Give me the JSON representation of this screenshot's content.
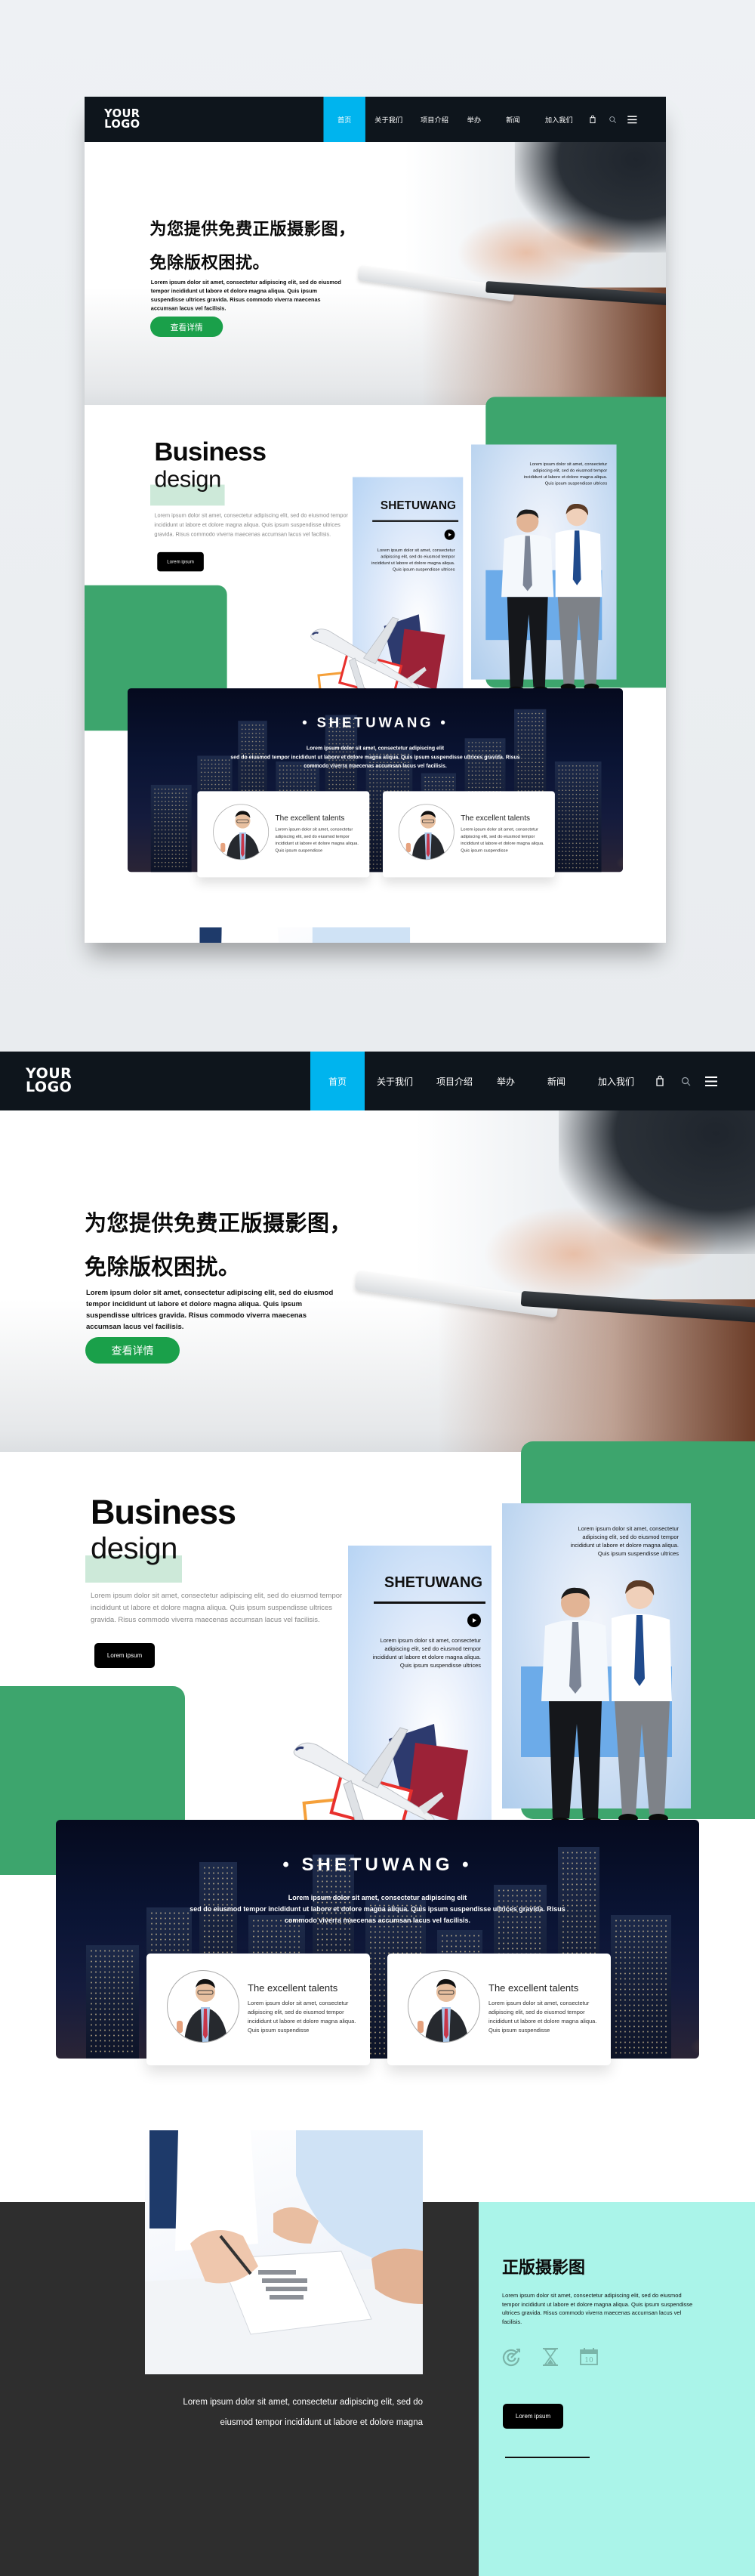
{
  "nav": {
    "logo_line1": "YOUR",
    "logo_line2": "LOGO",
    "items": [
      {
        "label": "首页",
        "active": true
      },
      {
        "label": "关于我们"
      },
      {
        "label": "项目介绍"
      },
      {
        "label": "举办"
      },
      {
        "label": "新闻"
      },
      {
        "label": "加入我们"
      }
    ],
    "icons": [
      "bag-icon",
      "search-icon",
      "menu-icon"
    ]
  },
  "hero": {
    "title_line1": "为您提供免费正版摄影图，",
    "title_line2": "免除版权困扰。",
    "body": "Lorem ipsum dolor sit amet, consectetur adipiscing elit, sed do eiusmod tempor incididunt ut labore et dolore magna aliqua. Quis ipsum suspendisse ultrices gravida. Risus commodo viverra maecenas accumsan lacus vel facilisis.",
    "button": "查看详情"
  },
  "business": {
    "title": "Business",
    "subtitle": "design",
    "body": "Lorem ipsum dolor sit amet, consectetur adipiscing elit, sed do eiusmod tempor incididunt ut labore et dolore magna aliqua. Quis ipsum suspendisse ultrices gravida. Risus commodo viverra maecenas accumsan lacus vel facilisis.",
    "button": "Lorem ipsum",
    "card1": {
      "title": "SHETUWANG",
      "text": "Lorem ipsum dolor sit amet, consectetur adipiscing elit, sed do eiusmod tempor incididunt ut labore et dolore magna aliqua. Quis ipsum suspendisse ultrices"
    },
    "card2": {
      "text": "Lorem ipsum dolor sit amet, consectetur adipiscing elit, sed do eiusmod tempor incididunt ut labore et dolore magna aliqua. Quis ipsum suspendisse ultrices"
    }
  },
  "city": {
    "title": "• SHETUWANG •",
    "body_line1": "Lorem ipsum dolor sit amet, consectetur adipiscing elit",
    "body_line2": "sed do eiusmod tempor incididunt ut labore et dolore magna aliqua. Quis ipsum suspendisse ultrices gravida. Risus",
    "body_line3": "commodo viverra maecenas accumsan lacus vel facilisis."
  },
  "talents": [
    {
      "name": "The excellent talents",
      "text": "Lorem ipsum dolor sit amet, consectetur adipiscing elit, sed do eiusmod tempor incididunt ut labore et dolore magna aliqua. Quis ipsum suspendisse"
    },
    {
      "name": "The excellent talents",
      "text": "Lorem ipsum dolor sit amet, consectetur adipiscing elit, sed do eiusmod tempor incididunt ut labore et dolore magna aliqua. Quis ipsum suspendisse"
    }
  ],
  "bottom": {
    "caption_line1": "Lorem ipsum dolor sit amet, consectetur adipiscing elit, sed do",
    "caption_line2": "eiusmod tempor incididunt ut labore et dolore magna",
    "title": "正版摄影图",
    "body": "Lorem ipsum dolor sit amet, consectetur adipiscing elit, sed do eiusmod tempor incididunt ut labore et dolore magna aliqua. Quis ipsum suspendisse ultrices gravida. Risus commodo viverra maecenas accumsan lacus vel facilisis.",
    "icons": [
      "target-icon",
      "hourglass-icon",
      "calendar-icon"
    ],
    "calendar_day": "10",
    "button": "Lorem ipsum"
  },
  "colors": {
    "nav_bg": "#0e151c",
    "nav_active": "#00b4ee",
    "hero_button": "#1aa04a",
    "green_block": "#3da56d",
    "mint": "#aaf4e9",
    "dark_band": "#2e2e2e"
  }
}
